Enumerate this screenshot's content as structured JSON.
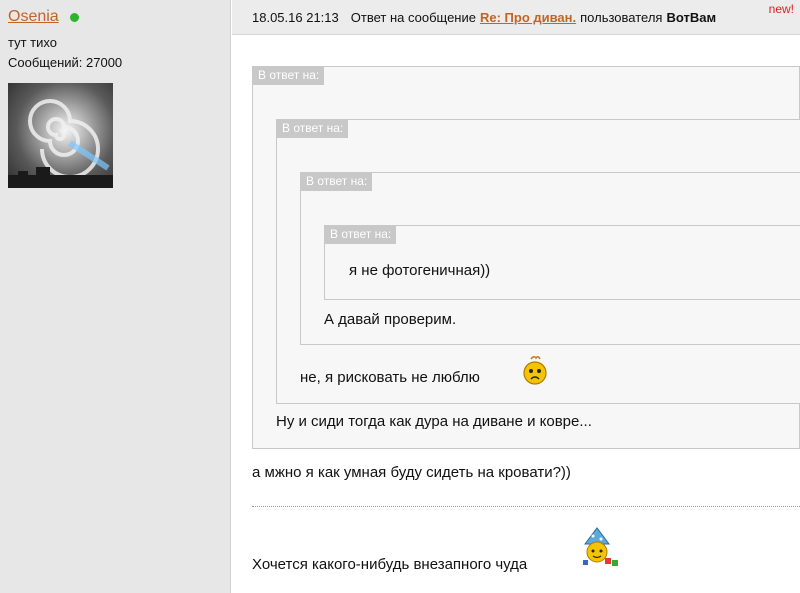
{
  "user": {
    "name": "Osenia",
    "status": "тут тихо",
    "posts": "Сообщений: 27000"
  },
  "header": {
    "date": "18.05.16 21:13",
    "reply_prefix": "Ответ на сообщение",
    "topic": "Re: Про диван.",
    "by_label": "пользователя",
    "author": "ВотВам",
    "new_badge": "new!"
  },
  "quotes": {
    "label": "В ответ на:",
    "level4_text": "я не фотогеничная))",
    "level3_text": "А давай проверим.",
    "level2_text": "не, я рисковать не люблю",
    "level1_text": "Ну и сиди тогда как дура на диване и ковре..."
  },
  "reply_text": "а мжно я как умная буду сидеть на кровати?))",
  "signature": "Хочется какого-нибудь внезапного чуда",
  "colors": {
    "link": "#c0652a",
    "online": "#2bb52b",
    "new_badge": "#e02020",
    "quote_label_bg": "#c8c8c8"
  },
  "icons": {
    "online_indicator": "green-dot",
    "smiley": "sad-smiley",
    "signature_image": "wizard-smiley"
  }
}
